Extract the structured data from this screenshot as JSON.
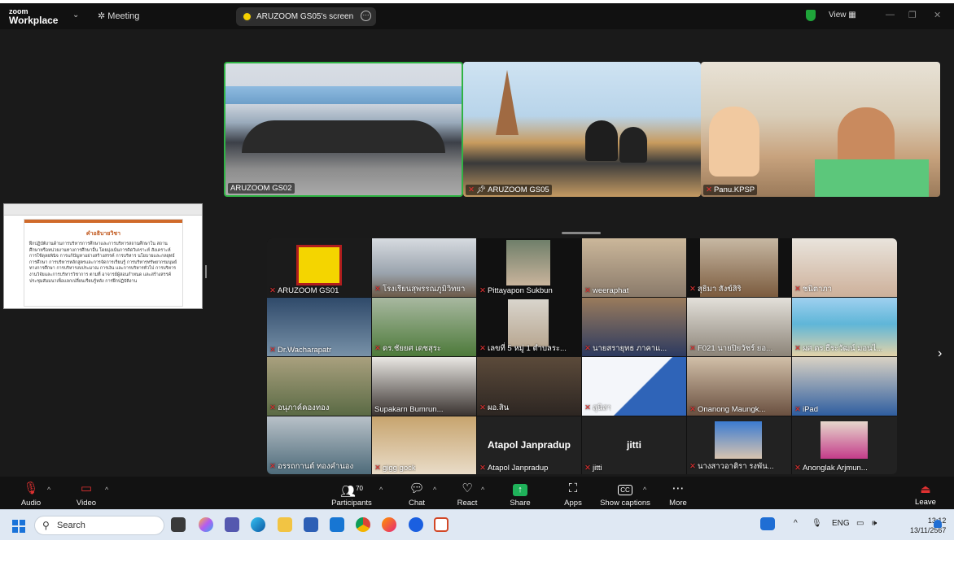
{
  "title_bar": {
    "logo_top": "zoom",
    "logo_bottom": "Workplace",
    "meeting_label": "Meeting",
    "share_label": "ARUZOOM GS05's screen",
    "view_label": "View"
  },
  "speakers": [
    {
      "name": "ARUZOOM GS02"
    },
    {
      "name": "ARUZOOM GS05"
    },
    {
      "name": "Panu.KPSP"
    }
  ],
  "shared_doc": {
    "heading": "คำอธิบายวิชา",
    "body": "ฝึกปฏิบัติงานด้านการบริหารการศึกษาและการบริหารสถานศึกษาใน สถานศึกษาหรือหน่วยงานทางการศึกษาอื่น โดยมุ่งเน้นการคิดวิเคราะห์ สังเคราะห์ การใช้ดุลยพินิจ การแก้ปัญหาอย่างสร้างสรรค์ การบริหาร นโยบายและกลยุทธ์การศึกษา การบริหารหลักสูตรและการจัดการเรียนรู้ การบริหารทรัพยากรมนุษย์ทางการศึกษา การบริหารงบประมาณ การเงิน และการบริหารทั่วไป การบริหารงานวิจัยและการบริหารวิชาการ ตามที่ อาจารย์ผู้สอนกำหนด และสร้างสรรค์ประชุมสัมมนาเพื่อแลกเปลี่ยนเรียนรู้หลัง การฝึกปฏิบัติงาน"
  },
  "gallery": [
    {
      "name": "ARUZOOM GS01"
    },
    {
      "name": "โรงเรียนสุพรรณภูมิวิทยา"
    },
    {
      "name": "Pittayapon Sukbun"
    },
    {
      "name": "weeraphat"
    },
    {
      "name": "สุธิมา สังข์สิริ"
    },
    {
      "name": "ชนิตาภา"
    },
    {
      "name": "Dr.Wacharapatr"
    },
    {
      "name": "ดร.ชัยยศ เดชสุระ"
    },
    {
      "name": "เลขที่ 5 หมู่ 1 ตำบลระ..."
    },
    {
      "name": "นายสรายุทธ ภาคาแ..."
    },
    {
      "name": "F021 นายปิยวัชร์ ยอ..."
    },
    {
      "name": "ผศ.ดร.ธีระวัฒน์ มอนไ..."
    },
    {
      "name": "อนุภาค์คองทอง"
    },
    {
      "name": "Supakarn Bumrun..."
    },
    {
      "name": "ผอ.สิน"
    },
    {
      "name": "สุนิสา"
    },
    {
      "name": "Onanong Maungk..."
    },
    {
      "name": "iPad"
    },
    {
      "name": "อรรถกานต์ ทองคำนอง"
    },
    {
      "name": "gigg gock"
    },
    {
      "name": "Atapol Janpradup",
      "display": "Atapol Janpradup"
    },
    {
      "name": "jitti",
      "display": "jitti"
    },
    {
      "name": "นางสาวอาติรา รงพัน..."
    },
    {
      "name": "Anonglak Arjmun..."
    }
  ],
  "toolbar": {
    "audio": "Audio",
    "video": "Video",
    "participants": "Participants",
    "participants_count": "70",
    "chat": "Chat",
    "react": "React",
    "share": "Share",
    "apps": "Apps",
    "captions": "Show captions",
    "more": "More",
    "leave": "Leave"
  },
  "taskbar": {
    "search_placeholder": "Search",
    "lang": "ENG",
    "time": "13:12",
    "date": "13/11/2567"
  },
  "colors": {
    "active_speaker_border": "#2fb344",
    "share_accent": "#1fb25a",
    "muted": "#e03131"
  }
}
